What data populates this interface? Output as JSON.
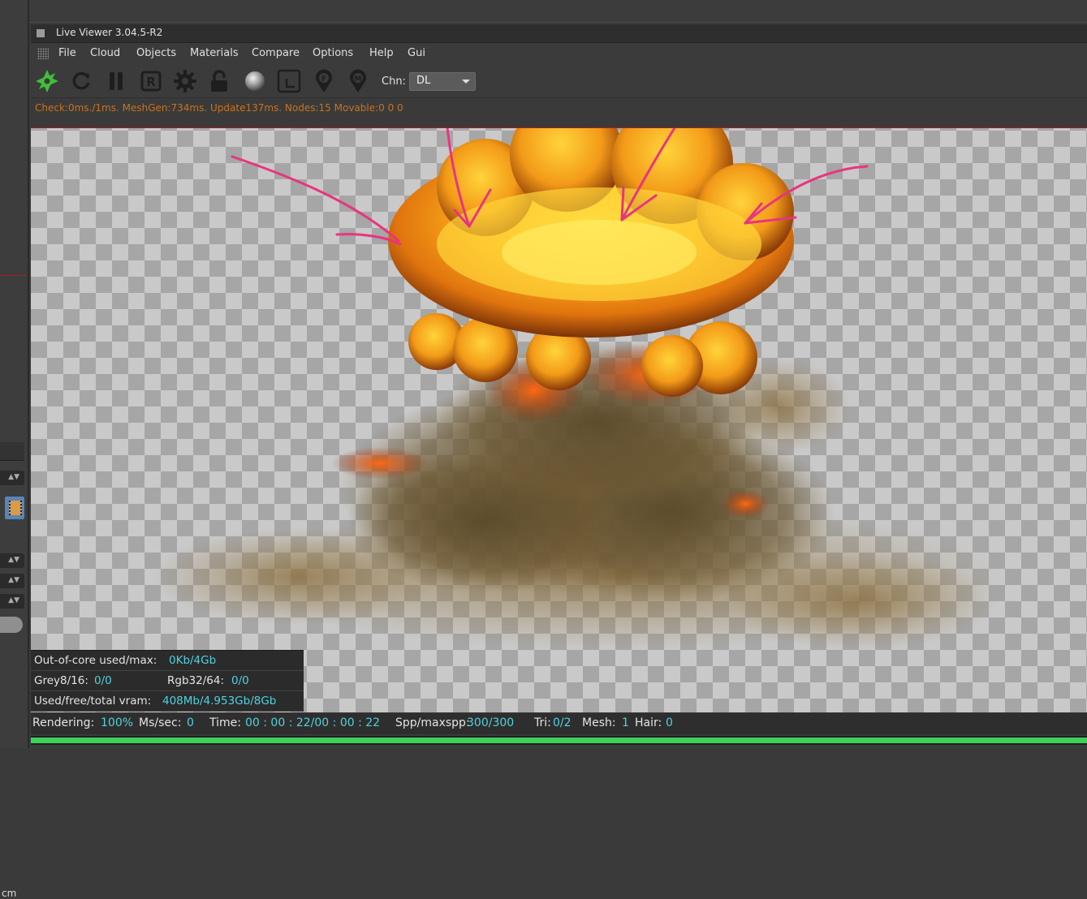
{
  "window": {
    "title": "Live Viewer 3.04.5-R2"
  },
  "host": {
    "unit_label": "cm"
  },
  "menu": [
    "File",
    "Cloud",
    "Objects",
    "Materials",
    "Compare",
    "Options",
    "Help",
    "Gui"
  ],
  "toolbar": {
    "icons": [
      "octane-logo-icon",
      "refresh-icon",
      "pause-icon",
      "r-lock-icon",
      "settings-gear-icon",
      "lock-icon",
      "material-sphere-icon",
      "region-render-icon",
      "focus-pick-icon",
      "material-pick-icon"
    ],
    "channel_label": "Chn:",
    "channel_value": "DL"
  },
  "viewport": {
    "stats": "Check:0ms./1ms. MeshGen:734ms. Update137ms. Nodes:15 Movable:0  0 0"
  },
  "info": {
    "out_of_core_label": "Out-of-core used/max:",
    "out_of_core_value": "0Kb/4Gb",
    "grey_label": "Grey8/16:",
    "grey_value": "0/0",
    "rgb_label": "Rgb32/64:",
    "rgb_value": "0/0",
    "vram_label": "Used/free/total vram:",
    "vram_value": "408Mb/4.953Gb/8Gb"
  },
  "status": {
    "rendering_label": "Rendering:",
    "rendering_value": "100%",
    "mssec_label": "Ms/sec:",
    "mssec_value": "0",
    "time_label": "Time:",
    "time_value": "00 : 00 : 22/00 : 00 : 22",
    "spp_label": "Spp/maxspp:",
    "spp_value": "300/300",
    "tri_label": "Tri:",
    "tri_value": "0/2",
    "mesh_label": "Mesh:",
    "mesh_value": "1",
    "hair_label": "Hair:",
    "hair_value": "0",
    "progress": 1.0
  },
  "colors": {
    "accent_green": "#3fd25a",
    "value_cyan": "#4fd2e0",
    "stats_orange": "#c8721e",
    "annotation_pink": "#e8357f"
  }
}
